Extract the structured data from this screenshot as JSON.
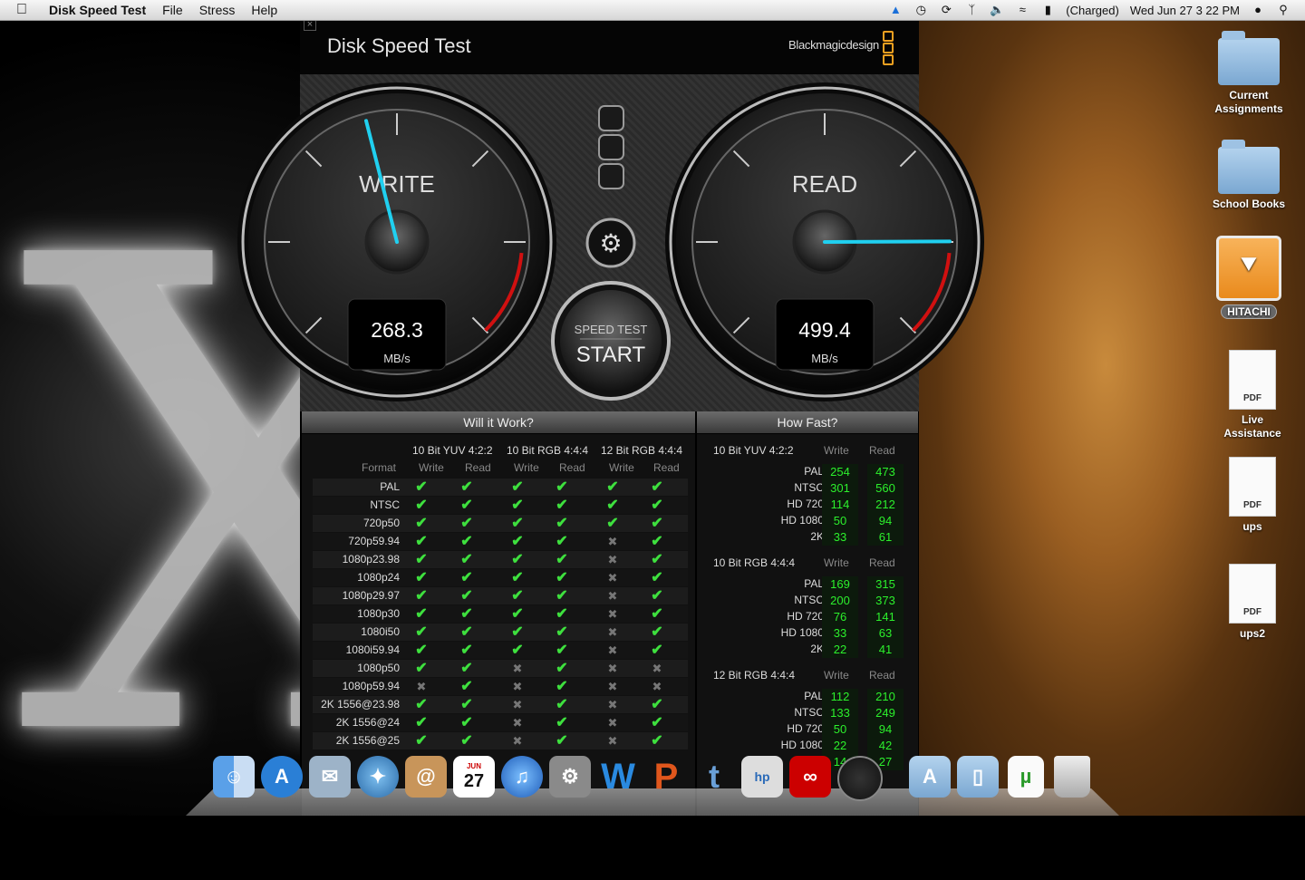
{
  "menubar": {
    "app_name": "Disk Speed Test",
    "menus": [
      "File",
      "Stress",
      "Help"
    ],
    "battery_status": "(Charged)",
    "datetime": "Wed Jun 27  3 22 PM"
  },
  "window": {
    "title": "Disk Speed Test",
    "brand": "Blackmagicdesign",
    "accent_color": "#f0a020"
  },
  "gauges": {
    "write": {
      "label": "WRITE",
      "value": "268.3",
      "unit": "MB/s"
    },
    "read": {
      "label": "READ",
      "value": "499.4",
      "unit": "MB/s"
    },
    "start_button": {
      "top": "SPEED TEST",
      "main": "START"
    },
    "needle_color": "#20d0f0"
  },
  "will_it_work": {
    "title": "Will it Work?",
    "format_header": "Format",
    "groups": [
      "10 Bit YUV 4:2:2",
      "10 Bit RGB 4:4:4",
      "12 Bit RGB 4:4:4"
    ],
    "write_label": "Write",
    "read_label": "Read",
    "rows": [
      {
        "format": "PAL",
        "marks": [
          1,
          1,
          1,
          1,
          1,
          1
        ]
      },
      {
        "format": "NTSC",
        "marks": [
          1,
          1,
          1,
          1,
          1,
          1
        ]
      },
      {
        "format": "720p50",
        "marks": [
          1,
          1,
          1,
          1,
          1,
          1
        ]
      },
      {
        "format": "720p59.94",
        "marks": [
          1,
          1,
          1,
          1,
          0,
          1
        ]
      },
      {
        "format": "1080p23.98",
        "marks": [
          1,
          1,
          1,
          1,
          0,
          1
        ]
      },
      {
        "format": "1080p24",
        "marks": [
          1,
          1,
          1,
          1,
          0,
          1
        ]
      },
      {
        "format": "1080p29.97",
        "marks": [
          1,
          1,
          1,
          1,
          0,
          1
        ]
      },
      {
        "format": "1080p30",
        "marks": [
          1,
          1,
          1,
          1,
          0,
          1
        ]
      },
      {
        "format": "1080i50",
        "marks": [
          1,
          1,
          1,
          1,
          0,
          1
        ]
      },
      {
        "format": "1080i59.94",
        "marks": [
          1,
          1,
          1,
          1,
          0,
          1
        ]
      },
      {
        "format": "1080p50",
        "marks": [
          1,
          1,
          0,
          1,
          0,
          0
        ]
      },
      {
        "format": "1080p59.94",
        "marks": [
          0,
          1,
          0,
          1,
          0,
          0
        ]
      },
      {
        "format": "2K 1556@23.98",
        "marks": [
          1,
          1,
          0,
          1,
          0,
          1
        ]
      },
      {
        "format": "2K 1556@24",
        "marks": [
          1,
          1,
          0,
          1,
          0,
          1
        ]
      },
      {
        "format": "2K 1556@25",
        "marks": [
          1,
          1,
          0,
          1,
          0,
          1
        ]
      }
    ]
  },
  "how_fast": {
    "title": "How Fast?",
    "write_label": "Write",
    "read_label": "Read",
    "groups": [
      {
        "name": "10 Bit YUV 4:2:2",
        "rows": [
          {
            "format": "PAL",
            "write": "254",
            "read": "473"
          },
          {
            "format": "NTSC",
            "write": "301",
            "read": "560"
          },
          {
            "format": "HD 720",
            "write": "114",
            "read": "212"
          },
          {
            "format": "HD 1080",
            "write": "50",
            "read": "94"
          },
          {
            "format": "2K",
            "write": "33",
            "read": "61"
          }
        ]
      },
      {
        "name": "10 Bit RGB 4:4:4",
        "rows": [
          {
            "format": "PAL",
            "write": "169",
            "read": "315"
          },
          {
            "format": "NTSC",
            "write": "200",
            "read": "373"
          },
          {
            "format": "HD 720",
            "write": "76",
            "read": "141"
          },
          {
            "format": "HD 1080",
            "write": "33",
            "read": "63"
          },
          {
            "format": "2K",
            "write": "22",
            "read": "41"
          }
        ]
      },
      {
        "name": "12 Bit RGB 4:4:4",
        "rows": [
          {
            "format": "PAL",
            "write": "112",
            "read": "210"
          },
          {
            "format": "NTSC",
            "write": "133",
            "read": "249"
          },
          {
            "format": "HD 720",
            "write": "50",
            "read": "94"
          },
          {
            "format": "HD 1080",
            "write": "22",
            "read": "42"
          },
          {
            "format": "2K",
            "write": "14",
            "read": "27"
          }
        ]
      }
    ]
  },
  "desktop_icons": [
    {
      "label": "Current\nAssignments",
      "kind": "folder"
    },
    {
      "label": "School Books",
      "kind": "folder"
    },
    {
      "label": "HITACHI",
      "kind": "drive"
    },
    {
      "label": "Live\nAssistance",
      "kind": "pdf",
      "badge": "PDF"
    },
    {
      "label": "ups",
      "kind": "pdf",
      "badge": "PDF"
    },
    {
      "label": "ups2",
      "kind": "pdf",
      "badge": "PDF"
    }
  ],
  "dock": {
    "calendar_day": "27",
    "calendar_month": "JUN",
    "items": [
      "finder-icon",
      "app-store-icon",
      "mail-icon",
      "safari-icon",
      "contacts-icon",
      "calendar-icon",
      "itunes-icon",
      "system-preferences-icon",
      "word-icon",
      "powerpoint-icon",
      "tumblr-icon",
      "hp-printer-icon",
      "acrobat-icon",
      "disk-speed-test-icon",
      "applications-folder-icon",
      "documents-folder-icon",
      "utorrent-icon",
      "trash-icon"
    ]
  }
}
